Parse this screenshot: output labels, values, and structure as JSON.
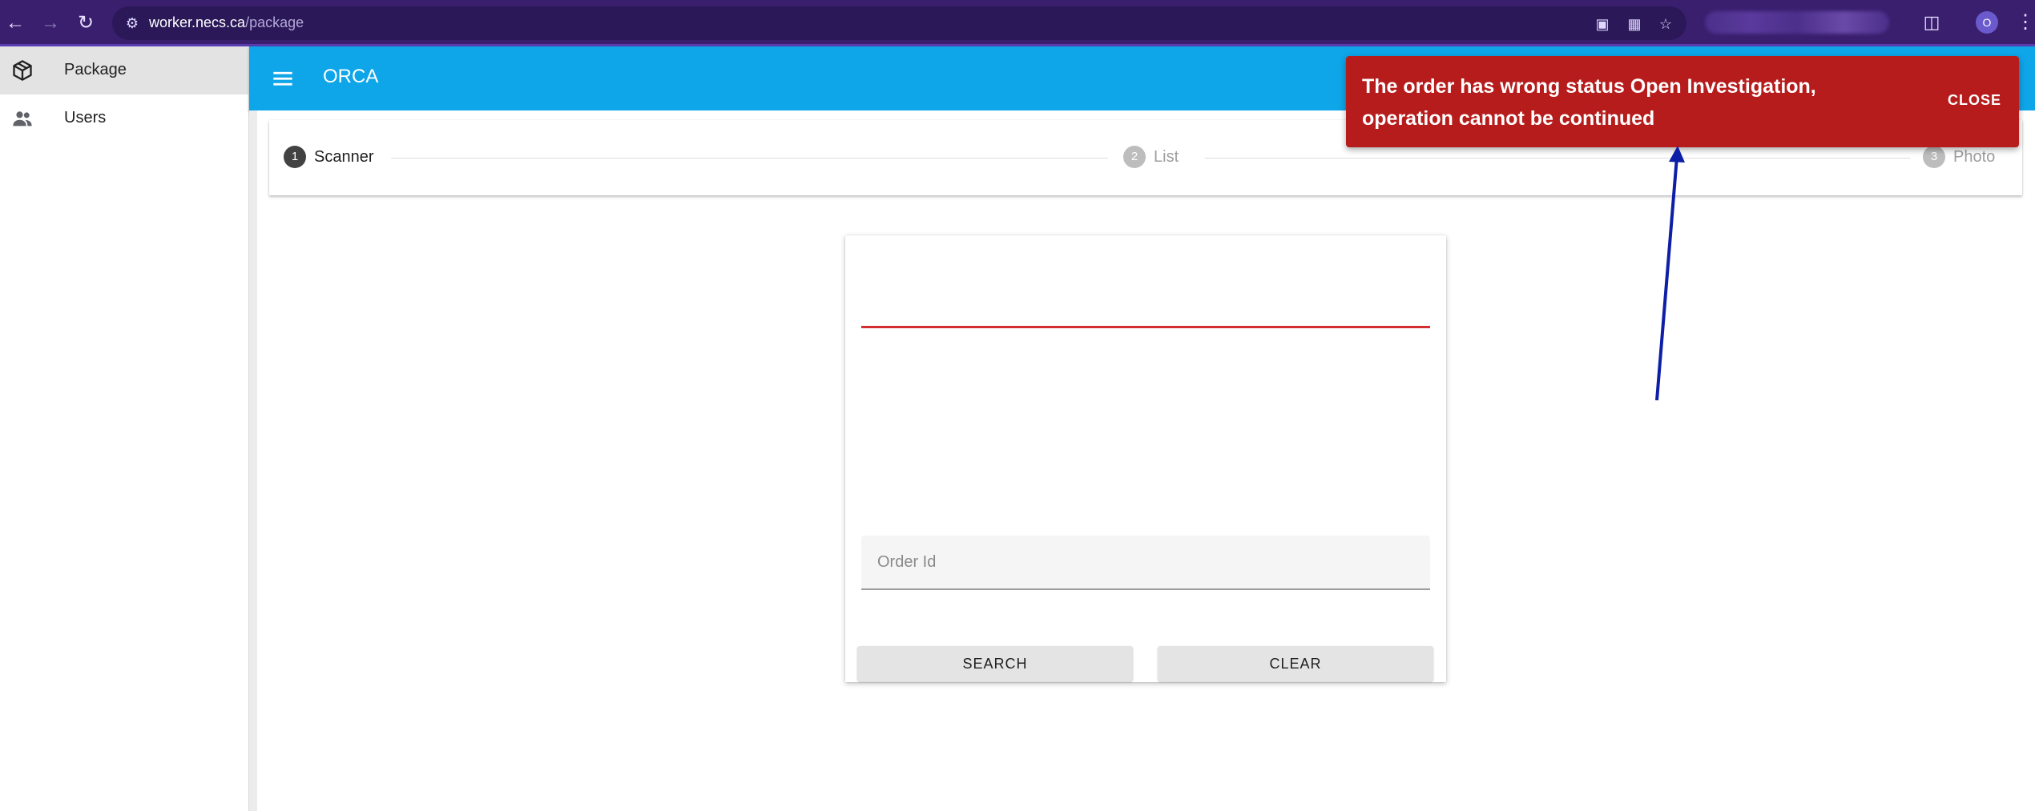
{
  "browser": {
    "url_host": "worker.necs.ca",
    "url_path": "/package",
    "profile_initial": "O"
  },
  "sidebar": {
    "items": [
      {
        "label": "Package",
        "icon": "package-icon",
        "active": true
      },
      {
        "label": "Users",
        "icon": "users-icon",
        "active": false
      }
    ]
  },
  "toolbar": {
    "title": "ORCA"
  },
  "stepper": {
    "steps": [
      {
        "number": "1",
        "label": "Scanner",
        "state": "active"
      },
      {
        "number": "2",
        "label": "List",
        "state": "inactive"
      },
      {
        "number": "3",
        "label": "Photo",
        "state": "inactive"
      }
    ]
  },
  "scanner": {
    "order_id_placeholder": "Order Id",
    "order_id_value": "",
    "search_label": "SEARCH",
    "clear_label": "CLEAR"
  },
  "snackbar": {
    "message": "The order has wrong status Open Investigation, operation cannot be continued",
    "close_label": "CLOSE",
    "color": "#b71c1c"
  },
  "colors": {
    "browser_bar": "#3a1f6e",
    "toolbar": "#0ea5e9",
    "scan_line": "#d32f2f",
    "annotation_arrow": "#0d1fa6"
  }
}
